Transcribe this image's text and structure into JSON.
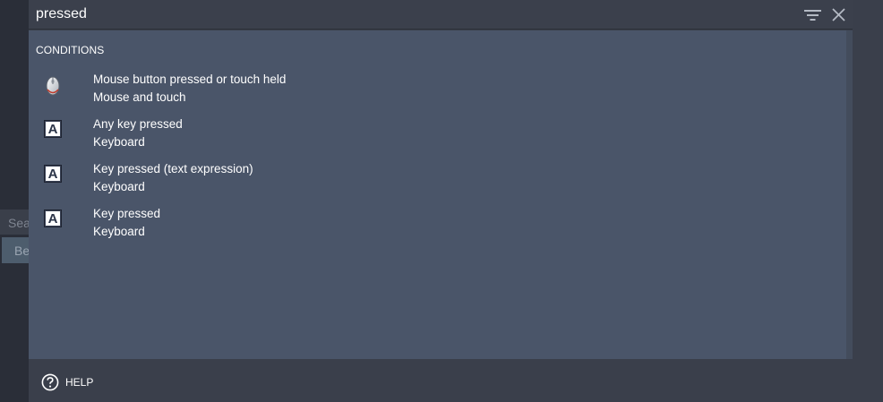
{
  "background": {
    "search_text": "Sea",
    "item_text": "Be"
  },
  "search": {
    "value": "pressed",
    "placeholder": ""
  },
  "toolbar": {
    "filter_icon": "filter-icon",
    "close_icon": "close-icon"
  },
  "list": {
    "section_header": "CONDITIONS",
    "items": [
      {
        "icon": "mouse-icon",
        "title": "Mouse button pressed or touch held",
        "subtitle": "Mouse and touch"
      },
      {
        "icon": "keyboard-icon",
        "icon_letter": "A",
        "title": "Any key pressed",
        "subtitle": "Keyboard"
      },
      {
        "icon": "keyboard-icon",
        "icon_letter": "A",
        "title": "Key pressed (text expression)",
        "subtitle": "Keyboard"
      },
      {
        "icon": "keyboard-icon",
        "icon_letter": "A",
        "title": "Key pressed",
        "subtitle": "Keyboard"
      }
    ]
  },
  "footer": {
    "help_icon": "help-icon",
    "help_label": "HELP"
  },
  "colors": {
    "list_bg": "#4a5569",
    "panel_bg": "#3a3f4b",
    "page_bg": "#262a34"
  }
}
